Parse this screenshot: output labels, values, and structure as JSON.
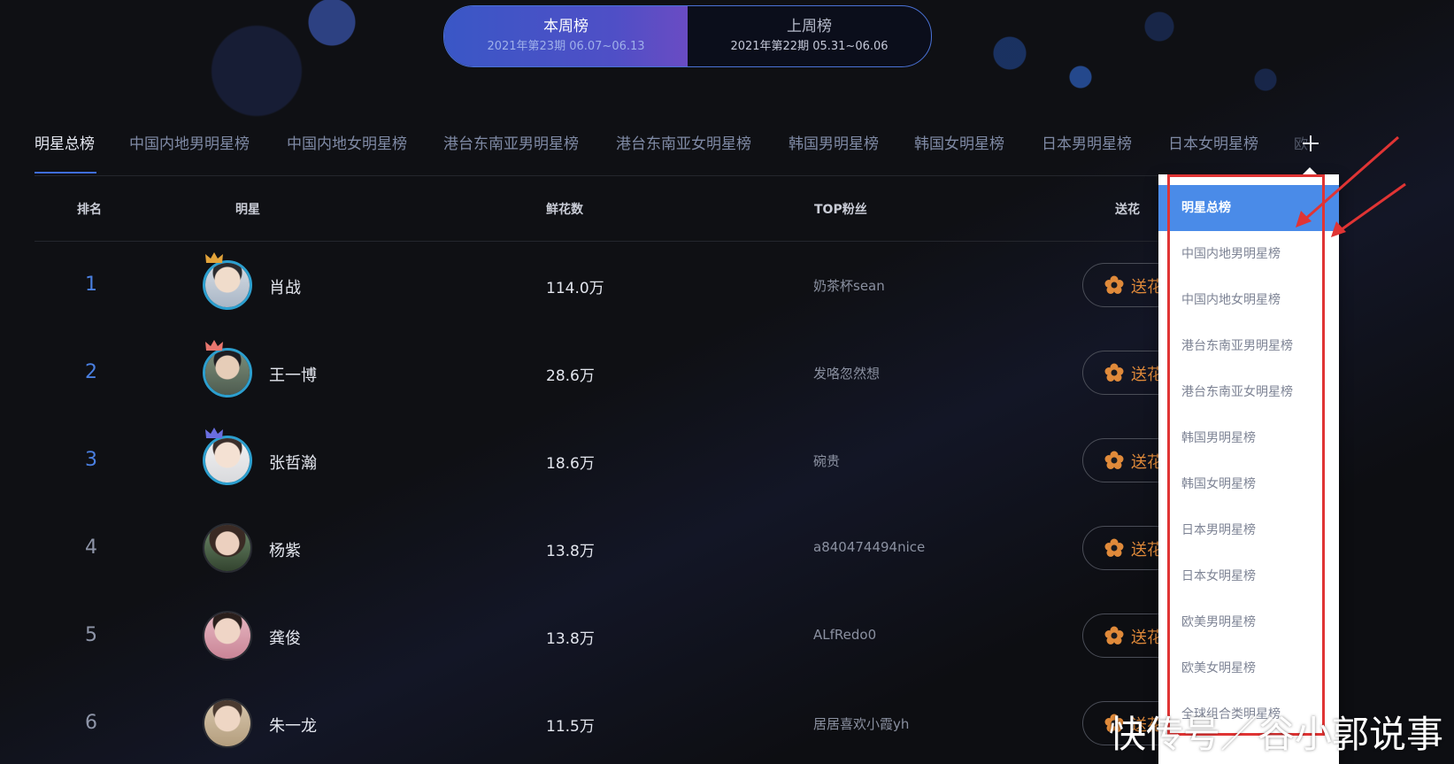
{
  "period_switch": {
    "this_week": {
      "title": "本周榜",
      "range": "2021年第23期 06.07~06.13"
    },
    "last_week": {
      "title": "上周榜",
      "range": "2021年第22期 05.31~06.06"
    }
  },
  "category_tabs": [
    "明星总榜",
    "中国内地男明星榜",
    "中国内地女明星榜",
    "港台东南亚男明星榜",
    "港台东南亚女明星榜",
    "韩国男明星榜",
    "韩国女明星榜",
    "日本男明星榜",
    "日本女明星榜"
  ],
  "more_tab_partial": "欧",
  "table": {
    "headers": {
      "rank": "排名",
      "star": "明星",
      "flowers": "鲜花数",
      "top_fan": "TOP粉丝",
      "send": "送花"
    },
    "rows": [
      {
        "rank": "1",
        "name": "肖战",
        "flowers": "114.0万",
        "top_fan": "奶茶杯sean",
        "crown": "gold"
      },
      {
        "rank": "2",
        "name": "王一博",
        "flowers": "28.6万",
        "top_fan": "发咯忽然想",
        "crown": "pink"
      },
      {
        "rank": "3",
        "name": "张哲瀚",
        "flowers": "18.6万",
        "top_fan": "碗贵",
        "crown": "purple"
      },
      {
        "rank": "4",
        "name": "杨紫",
        "flowers": "13.8万",
        "top_fan": "a840474494nice",
        "crown": ""
      },
      {
        "rank": "5",
        "name": "龚俊",
        "flowers": "13.8万",
        "top_fan": "ALfRedo0",
        "crown": ""
      },
      {
        "rank": "6",
        "name": "朱一龙",
        "flowers": "11.5万",
        "top_fan": "居居喜欢小霞yh",
        "crown": ""
      }
    ],
    "send_label": "送花"
  },
  "dropdown": {
    "items": [
      "明星总榜",
      "中国内地男明星榜",
      "中国内地女明星榜",
      "港台东南亚男明星榜",
      "港台东南亚女明星榜",
      "韩国男明星榜",
      "韩国女明星榜",
      "日本男明星榜",
      "日本女明星榜",
      "欧美男明星榜",
      "欧美女明星榜",
      "全球组合类明星榜"
    ],
    "active_index": 0
  },
  "watermark": "快传号／谷小郭说事",
  "colors": {
    "accent_blue": "#4a8be8",
    "rank_blue": "#4a7fe0",
    "send_orange": "#e08a3a",
    "annotation_red": "#e03434",
    "crown_gold": "#e2a33a",
    "crown_pink": "#e8766e",
    "crown_purple": "#6a6ee0"
  }
}
